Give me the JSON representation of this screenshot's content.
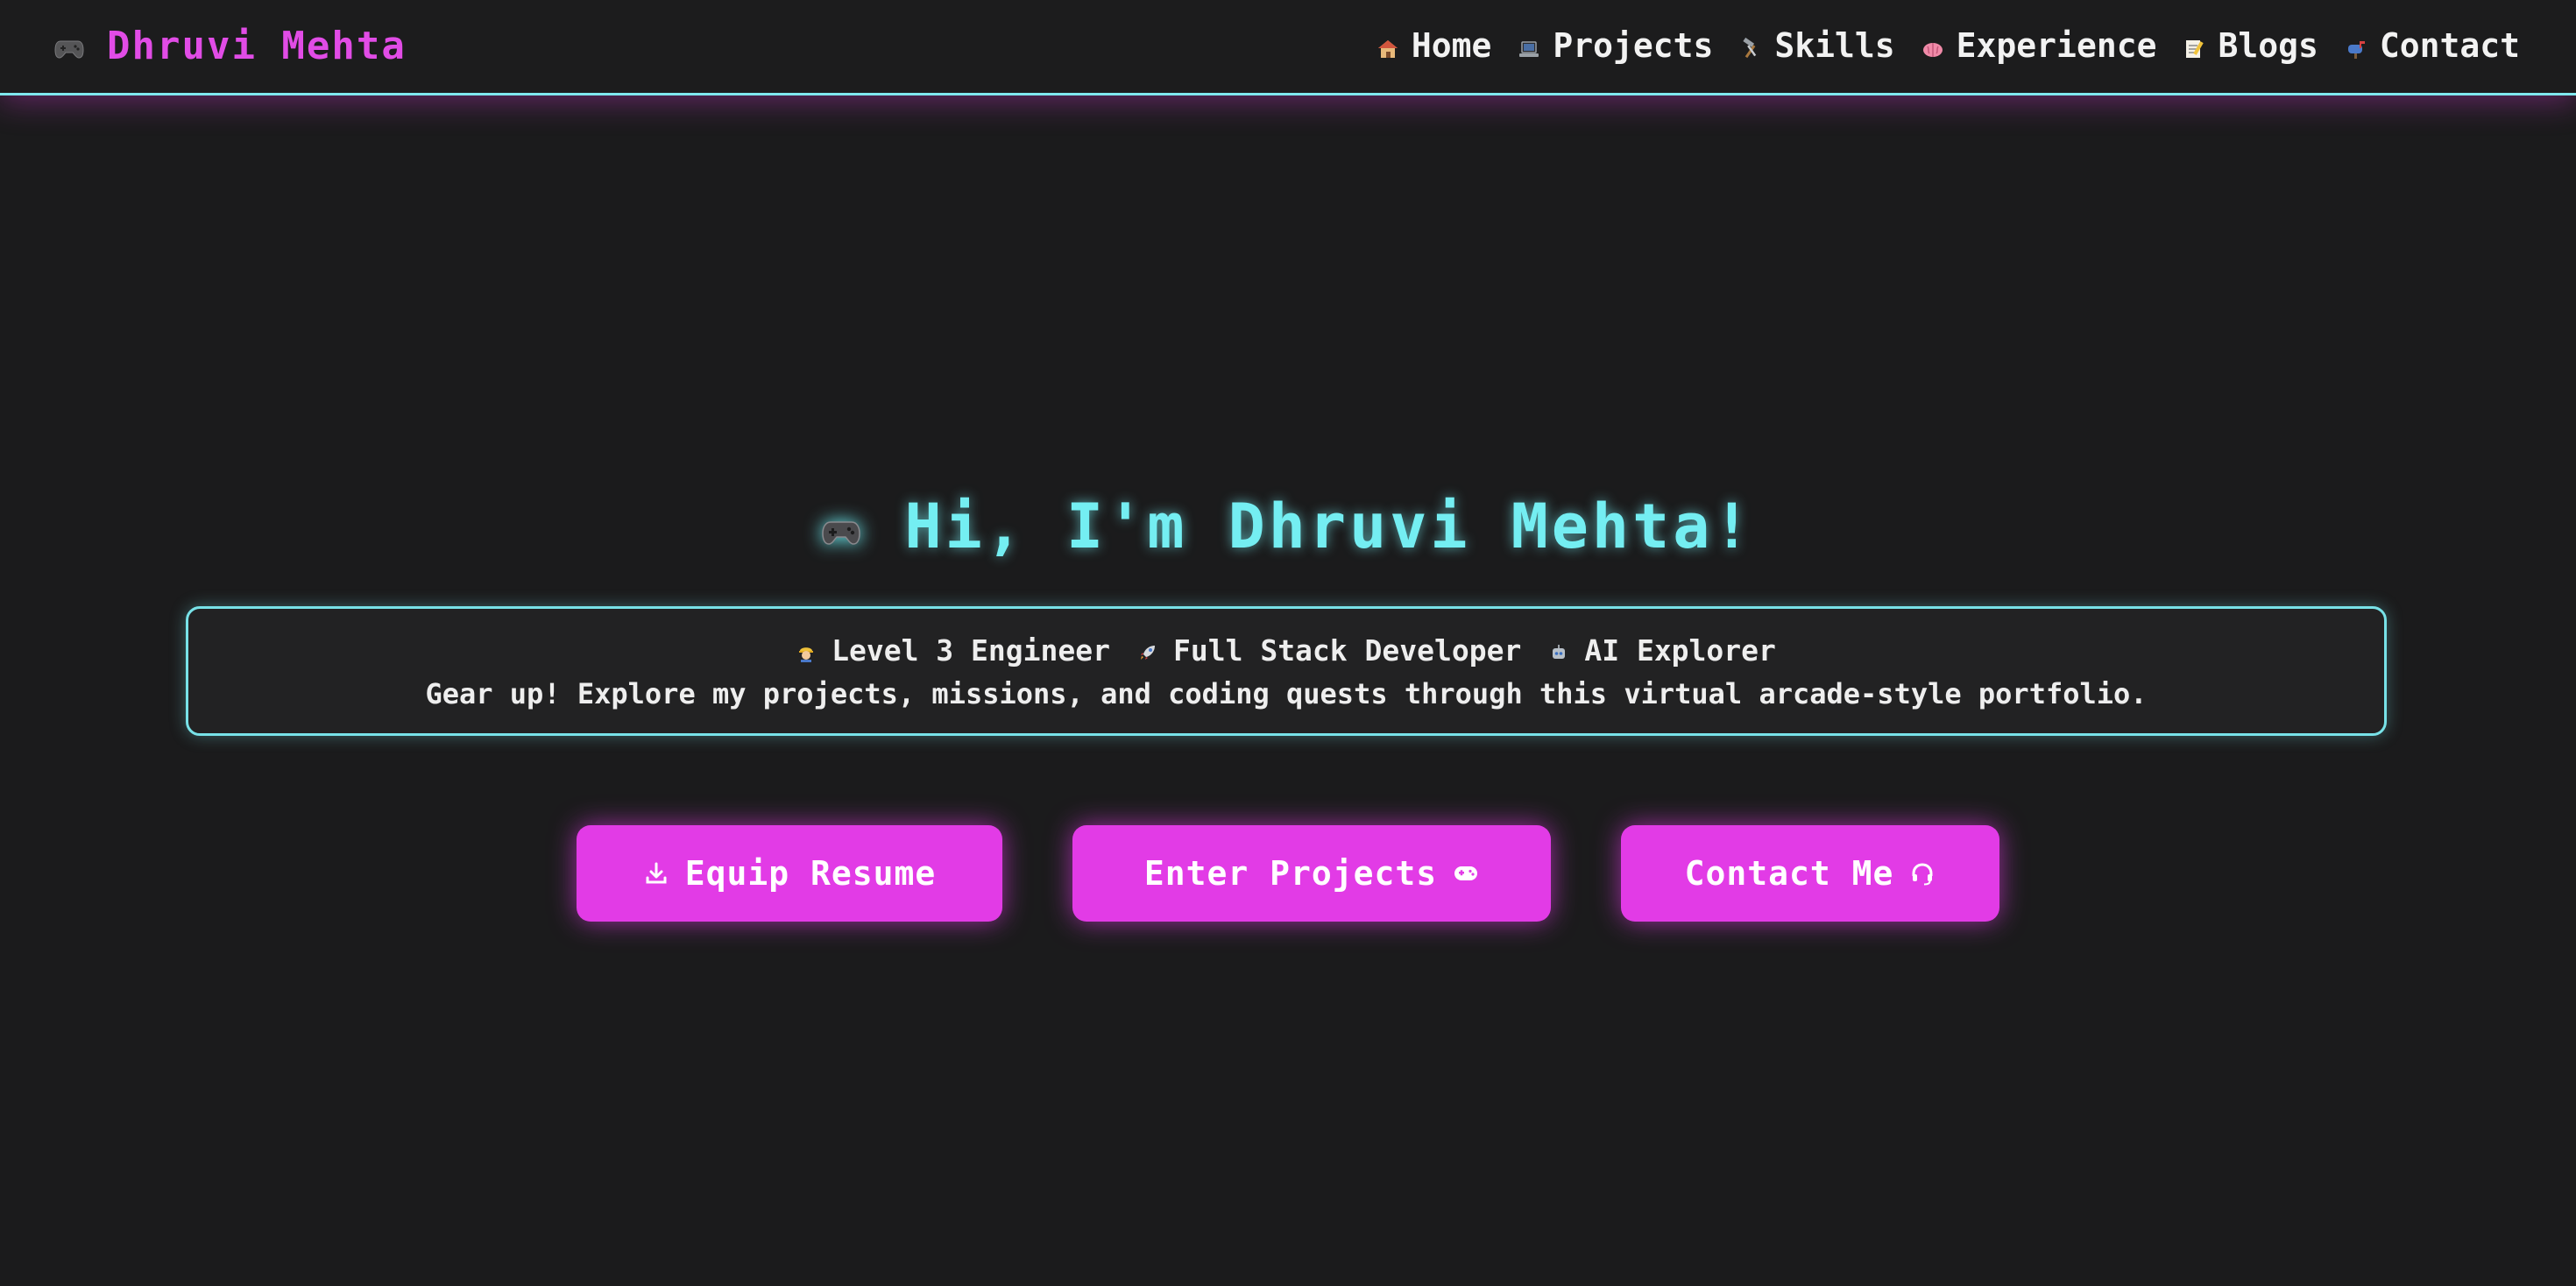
{
  "navbar": {
    "brand": {
      "icon": "gamepad-icon",
      "name": "Dhruvi Mehta"
    },
    "links": [
      {
        "icon": "house-icon",
        "label": "Home"
      },
      {
        "icon": "laptop-icon",
        "label": "Projects"
      },
      {
        "icon": "hammer-wrench-icon",
        "label": "Skills"
      },
      {
        "icon": "brain-icon",
        "label": "Experience"
      },
      {
        "icon": "memo-icon",
        "label": "Blogs"
      },
      {
        "icon": "mailbox-icon",
        "label": "Contact"
      }
    ]
  },
  "hero": {
    "icon": "gamepad-icon",
    "title": "Hi, I'm Dhruvi Mehta!",
    "roles": [
      {
        "icon": "engineer-icon",
        "label": "Level 3 Engineer"
      },
      {
        "icon": "rocket-icon",
        "label": "Full Stack Developer"
      },
      {
        "icon": "robot-icon",
        "label": "AI Explorer"
      }
    ],
    "tagline": "Gear up! Explore my projects, missions, and coding quests through this virtual arcade-style portfolio."
  },
  "actions": {
    "resume": {
      "icon": "download-icon",
      "label": "Equip Resume"
    },
    "projects": {
      "icon": "controller-icon",
      "label": "Enter Projects"
    },
    "contact": {
      "icon": "headset-icon",
      "label": "Contact Me"
    }
  },
  "colors": {
    "background": "#1b1b1c",
    "accent_magenta": "#e23be6",
    "accent_cyan": "#74eef2",
    "text": "#ececec"
  }
}
